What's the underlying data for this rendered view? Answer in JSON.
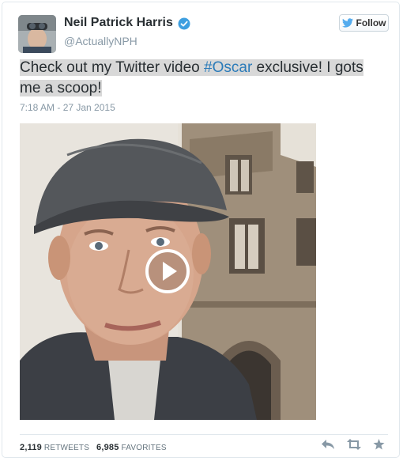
{
  "tweet": {
    "display_name": "Neil Patrick Harris",
    "handle": "@ActuallyNPH",
    "text_before": "Check out my Twitter video ",
    "hashtag": "#Oscar",
    "text_after": " exclusive! I gots me a scoop!",
    "timestamp": "7:18 AM - 27 Jan 2015",
    "retweets_count": "2,119",
    "retweets_label": "RETWEETS",
    "favorites_count": "6,985",
    "favorites_label": "FAVORITES"
  },
  "follow_button": {
    "label": "Follow"
  },
  "icons": {
    "verified": "verified-badge-icon",
    "twitter_bird": "twitter-bird-icon",
    "play": "play-icon",
    "reply": "reply-icon",
    "retweet": "retweet-icon",
    "favorite": "star-icon"
  },
  "colors": {
    "hashtag": "#2b7bb9",
    "verified": "#3e9fe0",
    "twitter_blue": "#55acee",
    "muted": "#8899a6"
  }
}
